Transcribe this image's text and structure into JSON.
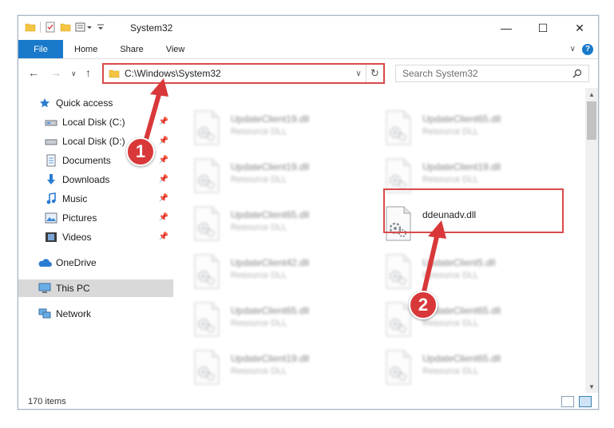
{
  "window": {
    "title": "System32"
  },
  "ribbon": {
    "tabs": [
      {
        "label": "File"
      },
      {
        "label": "Home"
      },
      {
        "label": "Share"
      },
      {
        "label": "View"
      }
    ],
    "help": "?"
  },
  "address": {
    "path": "C:\\Windows\\System32"
  },
  "search": {
    "placeholder": "Search System32"
  },
  "sidebar": {
    "items": [
      {
        "label": "Quick access",
        "icon": "star-icon",
        "pinned": false
      },
      {
        "label": "Local Disk (C:)",
        "icon": "drive-icon",
        "pinned": true
      },
      {
        "label": "Local Disk (D:)",
        "icon": "drive-icon",
        "pinned": true
      },
      {
        "label": "Documents",
        "icon": "documents-icon",
        "pinned": true
      },
      {
        "label": "Downloads",
        "icon": "download-icon",
        "pinned": true
      },
      {
        "label": "Music",
        "icon": "music-icon",
        "pinned": true
      },
      {
        "label": "Pictures",
        "icon": "pictures-icon",
        "pinned": true
      },
      {
        "label": "Videos",
        "icon": "videos-icon",
        "pinned": true
      },
      {
        "label": "OneDrive",
        "icon": "cloud-icon",
        "pinned": false
      },
      {
        "label": "This PC",
        "icon": "computer-icon",
        "pinned": false,
        "selected": true
      },
      {
        "label": "Network",
        "icon": "network-icon",
        "pinned": false
      }
    ]
  },
  "files": [
    {
      "name": "UpdateClient19.dll",
      "type": "Resource DLL"
    },
    {
      "name": "UpdateClient65.dll",
      "type": "Resource DLL"
    },
    {
      "name": "UpdateClient19.dll",
      "type": "Resource DLL"
    },
    {
      "name": "UpdateClient19.dll",
      "type": "Resource DLL"
    },
    {
      "name": "UpdateClient65.dll",
      "type": "Resource DLL"
    },
    {
      "name": "ddeunadv.dll",
      "type": ""
    },
    {
      "name": "UpdateClient42.dll",
      "type": "Resource DLL"
    },
    {
      "name": "UpdateClient5.dll",
      "type": "Resource DLL"
    },
    {
      "name": "UpdateClient65.dll",
      "type": "Resource DLL"
    },
    {
      "name": "UpdateClient65.dll",
      "type": "Resource DLL"
    },
    {
      "name": "UpdateClient19.dll",
      "type": "Resource DLL"
    },
    {
      "name": "UpdateClient65.dll",
      "type": "Resource DLL"
    }
  ],
  "status": {
    "item_count": "170 items"
  },
  "annotations": [
    {
      "label": "1"
    },
    {
      "label": "2"
    }
  ],
  "colors": {
    "accent": "#1979ca",
    "annotation": "#d9383a",
    "selection": "#d9d9d9"
  }
}
